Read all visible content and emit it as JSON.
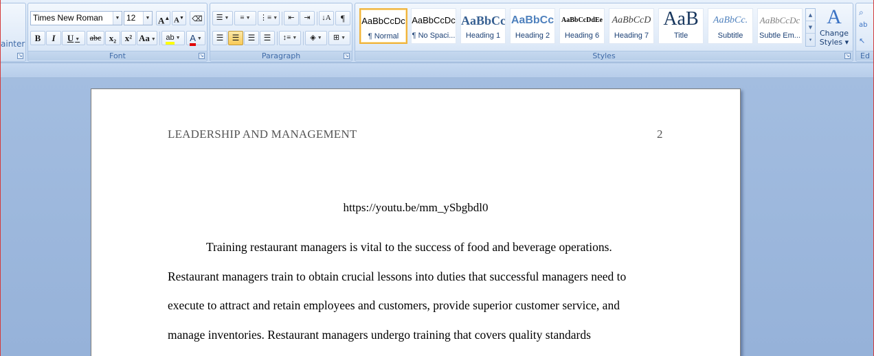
{
  "ribbon": {
    "clipboard": {
      "format_painter_label": "ainter"
    },
    "font": {
      "group_label": "Font",
      "font_name": "Times New Roman",
      "font_size": "12",
      "grow_label": "A",
      "shrink_label": "A",
      "bold_label": "B",
      "italic_label": "I",
      "underline_label": "U",
      "strike_label": "abc",
      "subscript_label": "x₂",
      "superscript_label": "x²",
      "change_case_label": "Aa",
      "highlight_label": "ab",
      "font_color_label": "A",
      "highlight_color": "#ffff00",
      "font_color": "#e00000"
    },
    "paragraph": {
      "group_label": "Paragraph",
      "pilcrow": "¶"
    },
    "styles": {
      "group_label": "Styles",
      "tiles": [
        {
          "preview": "AaBbCcDc",
          "name": "¶ Normal"
        },
        {
          "preview": "AaBbCcDc",
          "name": "¶ No Spaci..."
        },
        {
          "preview": "AaBbCc",
          "name": "Heading 1"
        },
        {
          "preview": "AaBbCc",
          "name": "Heading 2"
        },
        {
          "preview": "AaBbCcDdEe",
          "name": "Heading 6"
        },
        {
          "preview": "AaBbCcD",
          "name": "Heading 7"
        },
        {
          "preview": "AaB",
          "name": "Title"
        },
        {
          "preview": "AaBbCc.",
          "name": "Subtitle"
        },
        {
          "preview": "AaBbCcDc",
          "name": "Subtle Em..."
        }
      ],
      "change_styles_line1": "Change",
      "change_styles_line2": "Styles ▾"
    },
    "editing": {
      "group_label": "Ed"
    }
  },
  "document": {
    "running_head": "LEADERSHIP AND MANAGEMENT",
    "page_number": "2",
    "link": "https://youtu.be/mm_ySbgbdl0",
    "lines": [
      "Training restaurant managers is vital to the success of food and beverage operations.",
      "Restaurant managers train to obtain crucial lessons into duties that successful managers need to",
      "execute to attract and retain employees and customers, provide superior customer service, and",
      "manage inventories. Restaurant managers undergo training that covers quality standards"
    ]
  }
}
